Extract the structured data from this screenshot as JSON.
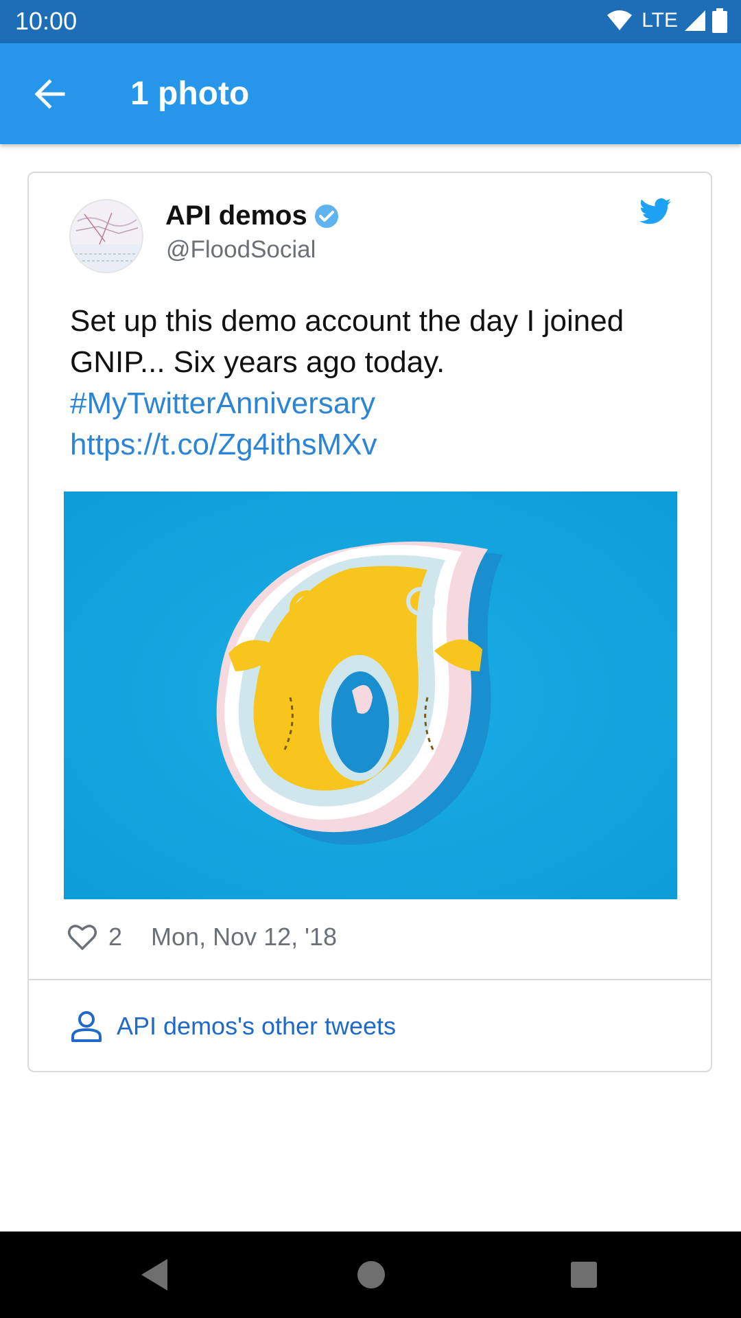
{
  "status_bar": {
    "time": "10:00",
    "network": "LTE"
  },
  "app_bar": {
    "title": "1 photo",
    "back_icon": "arrow-back-icon"
  },
  "tweet": {
    "user_name": "API demos",
    "handle": "@FloodSocial",
    "text": "Set up this demo account the day I joined GNIP... Six years ago today.",
    "hashtag": "#MyTwitterAnniversary",
    "link": "https://t.co/Zg4ithsMXv",
    "likes": "2",
    "date": "Mon, Nov 12, '18",
    "other_tweets_label": "API demos's other tweets"
  },
  "colors": {
    "status_bar": "#1e6db7",
    "app_bar": "#2596ea",
    "link": "#2b85d4",
    "twitter_blue": "#1da1f2",
    "photo_background": "#12a7e2",
    "photo_yellow": "#f8c51d"
  },
  "nav_bar": {
    "back_icon": "nav-back-icon",
    "home_icon": "nav-home-icon",
    "recents_icon": "nav-recents-icon"
  }
}
